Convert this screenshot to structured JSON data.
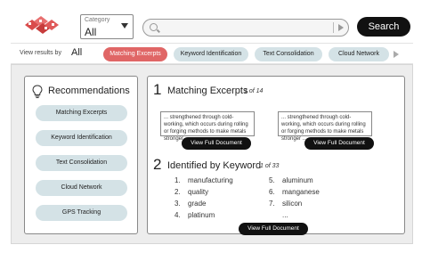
{
  "header": {
    "category_label": "Category",
    "category_value": "All",
    "search_placeholder": "",
    "search_button": "Search"
  },
  "filter_bar": {
    "label": "View results by",
    "all": "All",
    "chips": [
      "Matching Excerpts",
      "Keyword Identification",
      "Text Consolidation",
      "Cloud Network"
    ],
    "active_chip": 0
  },
  "recommendations": {
    "title": "Recommendations",
    "items": [
      "Matching Excerpts",
      "Keyword Identification",
      "Text Consolidation",
      "Cloud Network",
      "GPS Tracking"
    ]
  },
  "results": {
    "section1": {
      "number": "1",
      "title": "Matching Excerpts",
      "count": "1 of 14",
      "excerpts": [
        "... strengthened through cold-working, which occurs during rolling or forging methods to make metals stronger ...",
        "... strengthened through cold-working, which occurs during rolling or forging methods to make metals stronger ..."
      ],
      "button": "View Full Document"
    },
    "section2": {
      "number": "2",
      "title": "Identified by Keyword",
      "count": "1 of 33",
      "keywords_left": [
        {
          "n": "1.",
          "word": "manufacturing"
        },
        {
          "n": "2.",
          "word": "quality"
        },
        {
          "n": "3.",
          "word": "grade"
        },
        {
          "n": "4.",
          "word": "platinum"
        }
      ],
      "keywords_right": [
        {
          "n": "5.",
          "word": "aluminum"
        },
        {
          "n": "6.",
          "word": "manganese"
        },
        {
          "n": "7.",
          "word": "silicon"
        },
        {
          "n": "",
          "word": "..."
        }
      ],
      "button": "View Full Document"
    }
  },
  "colors": {
    "accent_active": "#e06666",
    "chip": "#d4e2e6",
    "button_dark": "#111111",
    "panel_bg": "#ededed"
  }
}
